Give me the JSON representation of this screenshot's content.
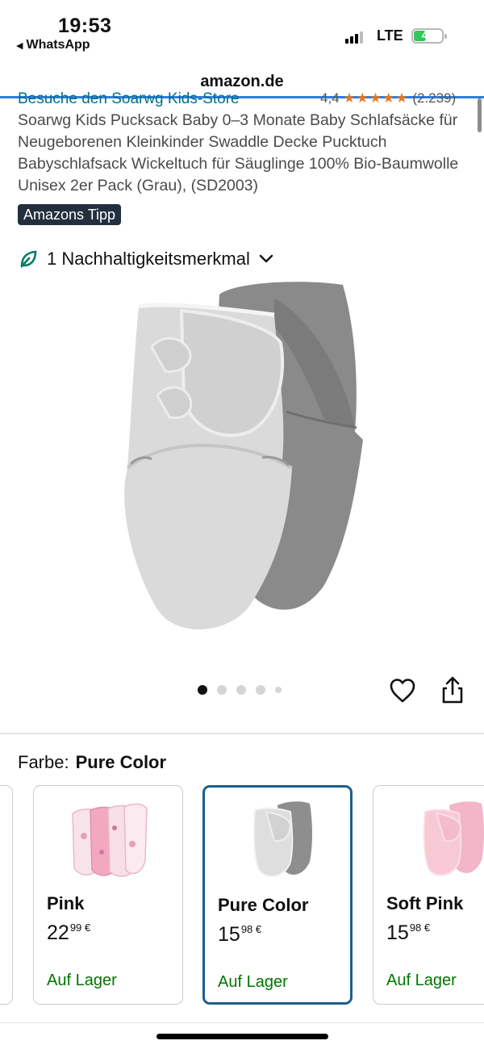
{
  "status_bar": {
    "time": "19:53",
    "back_app": "WhatsApp",
    "network": "LTE",
    "battery": "42"
  },
  "browser": {
    "url": "amazon.de"
  },
  "product": {
    "store_link": "Besuche den Soarwg Kids-Store",
    "rating_value": "4,4",
    "rating_stars": "★★★★★",
    "rating_count": "(2.239)",
    "title": "Soarwg Kids Pucksack Baby 0–3 Monate Baby Schlafsäcke für Neugeborenen Kleinkinder Swaddle Decke Pucktuch Babyschlafsack Wickeltuch für Säuglinge 100% Bio-Baumwolle Unisex 2er Pack (Grau), (SD2003)",
    "badge": "Amazons Tipp",
    "sustainability": "1 Nachhaltigkeitsmerkmal"
  },
  "carousel": {
    "total": 5,
    "active": 0
  },
  "colors": {
    "label": "Farbe:",
    "selected": "Pure Color",
    "options": [
      {
        "name": "Pink",
        "price_main": "22",
        "price_sup": "99 €",
        "stock": "Auf Lager"
      },
      {
        "name": "Pure Color",
        "price_main": "15",
        "price_sup": "98 €",
        "stock": "Auf Lager"
      },
      {
        "name": "Soft Pink",
        "price_main": "15",
        "price_sup": "98 €",
        "stock": "Auf Lager"
      }
    ]
  },
  "theme": {
    "link_color": "#007185",
    "stock_color": "#007600",
    "selected_border": "#1e5f8b",
    "badge_bg": "#232f3e",
    "star_color": "#de7921"
  }
}
